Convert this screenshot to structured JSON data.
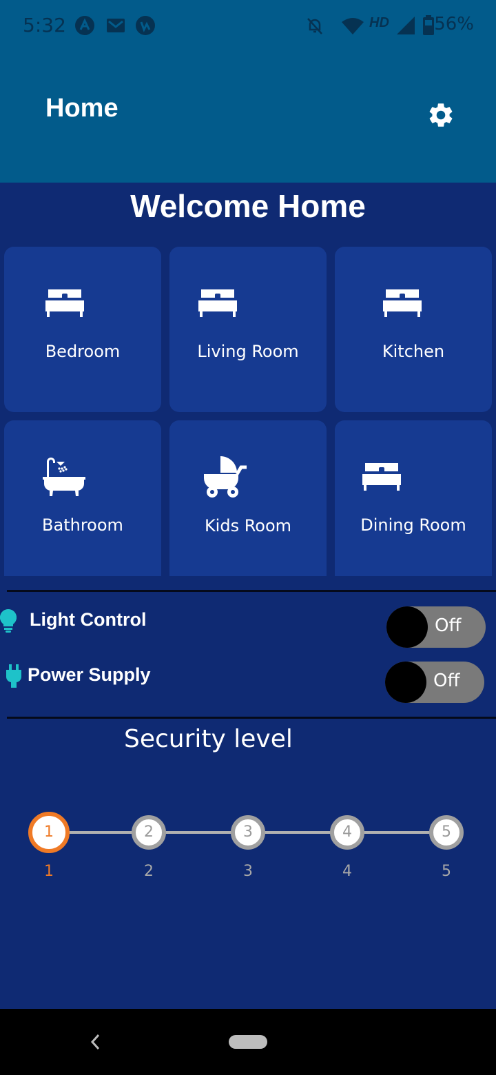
{
  "status_bar": {
    "time": "5:32",
    "network_badge": "HD",
    "battery": "56%",
    "icons": [
      "a-app-icon",
      "gmail-icon",
      "vpn-icon",
      "notifications-off-icon",
      "wifi-icon",
      "signal-icon",
      "battery-icon"
    ]
  },
  "app_bar": {
    "title": "Home",
    "settings_icon": "gear-icon"
  },
  "welcome": "Welcome Home",
  "rooms": [
    {
      "label": "Bedroom",
      "icon": "bed-icon"
    },
    {
      "label": "Living Room",
      "icon": "bed-icon"
    },
    {
      "label": "Kitchen",
      "icon": "bed-icon"
    },
    {
      "label": "Bathroom",
      "icon": "bathtub-icon"
    },
    {
      "label": "Kids Room",
      "icon": "stroller-icon"
    },
    {
      "label": "Dining Room",
      "icon": "bed-icon"
    }
  ],
  "controls": [
    {
      "label": "Light Control",
      "icon": "lightbulb-icon",
      "state": "Off"
    },
    {
      "label": "Power Supply",
      "icon": "plug-icon",
      "state": "Off"
    }
  ],
  "security": {
    "title": "Security level",
    "selected": 1,
    "steps": [
      "1",
      "2",
      "3",
      "4",
      "5"
    ],
    "step_labels": [
      "1",
      "2",
      "3",
      "4",
      "5"
    ]
  },
  "colors": {
    "app_bar": "#025b8b",
    "background": "#0f2a73",
    "card": "#163a91",
    "accent": "#ef7a26",
    "icon_teal": "#1ec2c9"
  }
}
